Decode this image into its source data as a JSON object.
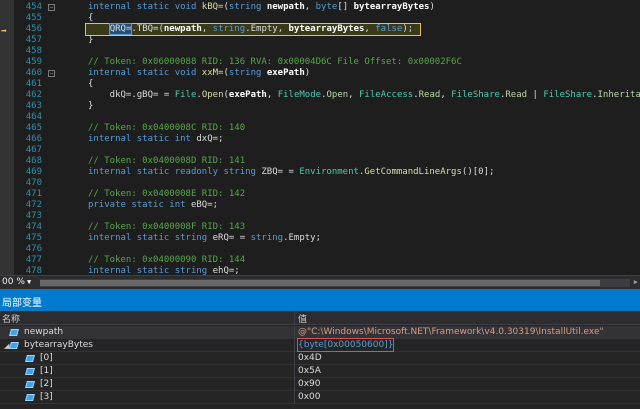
{
  "editor": {
    "lines": [
      {
        "no": "454",
        "parts": [
          {
            "t": "internal static void ",
            "c": "kw"
          },
          {
            "t": "kBQ=",
            "c": "fn"
          },
          {
            "t": "(",
            "c": "id"
          },
          {
            "t": "string",
            "c": "kw"
          },
          {
            "t": " newpath",
            "c": "bold"
          },
          {
            "t": ", ",
            "c": "id"
          },
          {
            "t": "byte",
            "c": "kw"
          },
          {
            "t": "[] ",
            "c": "id"
          },
          {
            "t": "bytearrayBytes",
            "c": "bold"
          },
          {
            "t": ")",
            "c": "id"
          }
        ]
      },
      {
        "no": "455",
        "parts": [
          {
            "t": "{",
            "c": "id"
          }
        ]
      },
      {
        "no": "456",
        "parts": [
          {
            "t": "    ",
            "c": "id"
          },
          {
            "t": "QRQ=",
            "c": "sel"
          },
          {
            "t": ".TBQ=(",
            "c": "id"
          },
          {
            "t": "newpath",
            "c": "bold"
          },
          {
            "t": ", ",
            "c": "id"
          },
          {
            "t": "string",
            "c": "kw"
          },
          {
            "t": ".Empty, ",
            "c": "id"
          },
          {
            "t": "bytearrayBytes",
            "c": "bold"
          },
          {
            "t": ", ",
            "c": "id"
          },
          {
            "t": "false",
            "c": "kw"
          },
          {
            "t": ");",
            "c": "id"
          }
        ]
      },
      {
        "no": "457",
        "parts": [
          {
            "t": "}",
            "c": "id"
          }
        ]
      },
      {
        "no": "458",
        "parts": []
      },
      {
        "no": "459",
        "parts": [
          {
            "t": "// Token: 0x06000088 RID: 136 RVA: 0x00004D6C File Offset: 0x00002F6C",
            "c": "cmt"
          }
        ]
      },
      {
        "no": "460",
        "parts": [
          {
            "t": "internal static void ",
            "c": "kw"
          },
          {
            "t": "xxM=",
            "c": "fn"
          },
          {
            "t": "(",
            "c": "id"
          },
          {
            "t": "string",
            "c": "kw"
          },
          {
            "t": " exePath",
            "c": "bold"
          },
          {
            "t": ")",
            "c": "id"
          }
        ]
      },
      {
        "no": "461",
        "parts": [
          {
            "t": "{",
            "c": "id"
          }
        ]
      },
      {
        "no": "462",
        "parts": [
          {
            "t": "    dkQ=.gBQ= = ",
            "c": "id"
          },
          {
            "t": "File",
            "c": "type"
          },
          {
            "t": ".",
            "c": "id"
          },
          {
            "t": "Open",
            "c": "fn"
          },
          {
            "t": "(",
            "c": "id"
          },
          {
            "t": "exePath",
            "c": "bold"
          },
          {
            "t": ", ",
            "c": "id"
          },
          {
            "t": "FileMode",
            "c": "type"
          },
          {
            "t": ".",
            "c": "id"
          },
          {
            "t": "Open",
            "c": "enum"
          },
          {
            "t": ", ",
            "c": "id"
          },
          {
            "t": "FileAccess",
            "c": "type"
          },
          {
            "t": ".",
            "c": "id"
          },
          {
            "t": "Read",
            "c": "enum"
          },
          {
            "t": ", ",
            "c": "id"
          },
          {
            "t": "FileShare",
            "c": "type"
          },
          {
            "t": ".",
            "c": "id"
          },
          {
            "t": "Read",
            "c": "enum"
          },
          {
            "t": " | ",
            "c": "id"
          },
          {
            "t": "FileShare",
            "c": "type"
          },
          {
            "t": ".",
            "c": "id"
          },
          {
            "t": "Inheritable",
            "c": "enum"
          }
        ]
      },
      {
        "no": "463",
        "parts": [
          {
            "t": "}",
            "c": "id"
          }
        ]
      },
      {
        "no": "464",
        "parts": []
      },
      {
        "no": "465",
        "parts": [
          {
            "t": "// Token: 0x0400008C RID: 140",
            "c": "cmt"
          }
        ]
      },
      {
        "no": "466",
        "parts": [
          {
            "t": "internal static int ",
            "c": "kw"
          },
          {
            "t": "dxQ=;",
            "c": "id"
          }
        ]
      },
      {
        "no": "467",
        "parts": []
      },
      {
        "no": "468",
        "parts": [
          {
            "t": "// Token: 0x0400008D RID: 141",
            "c": "cmt"
          }
        ]
      },
      {
        "no": "469",
        "parts": [
          {
            "t": "internal static readonly string ",
            "c": "kw"
          },
          {
            "t": "ZBQ= = ",
            "c": "id"
          },
          {
            "t": "Environment",
            "c": "type"
          },
          {
            "t": ".",
            "c": "id"
          },
          {
            "t": "GetCommandLineArgs",
            "c": "fn"
          },
          {
            "t": "()[0];",
            "c": "id"
          }
        ]
      },
      {
        "no": "470",
        "parts": []
      },
      {
        "no": "471",
        "parts": [
          {
            "t": "// Token: 0x0400008E RID: 142",
            "c": "cmt"
          }
        ]
      },
      {
        "no": "472",
        "parts": [
          {
            "t": "private static int ",
            "c": "kw"
          },
          {
            "t": "eBQ=;",
            "c": "id"
          }
        ]
      },
      {
        "no": "473",
        "parts": []
      },
      {
        "no": "474",
        "parts": [
          {
            "t": "// Token: 0x0400008F RID: 143",
            "c": "cmt"
          }
        ]
      },
      {
        "no": "475",
        "parts": [
          {
            "t": "internal static string ",
            "c": "kw"
          },
          {
            "t": "eRQ= = ",
            "c": "id"
          },
          {
            "t": "string",
            "c": "kw"
          },
          {
            "t": ".Empty;",
            "c": "id"
          }
        ]
      },
      {
        "no": "476",
        "parts": []
      },
      {
        "no": "477",
        "parts": [
          {
            "t": "// Token: 0x04000090 RID: 144",
            "c": "cmt"
          }
        ]
      },
      {
        "no": "478",
        "parts": [
          {
            "t": "internal static string ",
            "c": "kw"
          },
          {
            "t": "ehQ=;",
            "c": "id"
          }
        ]
      }
    ]
  },
  "zoom": {
    "value": "00 %"
  },
  "locals": {
    "title": "局部变量",
    "columns": {
      "name": "名称",
      "value": "值"
    },
    "rows": [
      {
        "expander": "",
        "indent": 0,
        "name": "newpath",
        "value": "@\"C:\\Windows\\Microsoft.NET\\Framework\\v4.0.30319\\InstallUtil.exe\"",
        "kind": "str",
        "selected": true
      },
      {
        "expander": "◢",
        "indent": 0,
        "name": "bytearrayBytes",
        "value": "{byte[0x00050600]}",
        "kind": "type",
        "selected": false
      },
      {
        "expander": "",
        "indent": 1,
        "name": "[0]",
        "value": "0x4D",
        "kind": "num",
        "selected": false
      },
      {
        "expander": "",
        "indent": 1,
        "name": "[1]",
        "value": "0x5A",
        "kind": "num",
        "selected": false
      },
      {
        "expander": "",
        "indent": 1,
        "name": "[2]",
        "value": "0x90",
        "kind": "num",
        "selected": false
      },
      {
        "expander": "",
        "indent": 1,
        "name": "[3]",
        "value": "0x00",
        "kind": "num",
        "selected": false
      }
    ]
  },
  "colors": {
    "accent": "#007acc",
    "lineNumber": "#2b91af",
    "keyword": "#569cd6",
    "comment": "#57a64a",
    "type": "#4ec9b0"
  }
}
